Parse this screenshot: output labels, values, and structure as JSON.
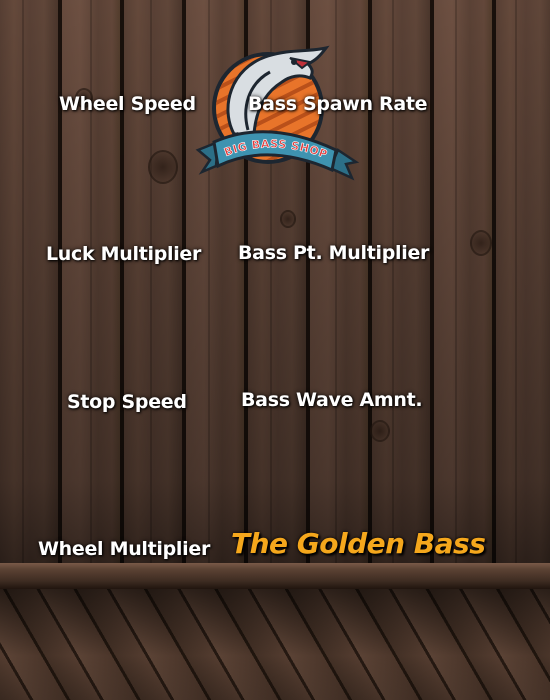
{
  "shop": {
    "logo_text": "BIG BASS SHOP",
    "upgrades": [
      "Wheel Speed",
      "Bass Spawn Rate",
      "Luck Multiplier",
      "Bass Pt. Multiplier",
      "Stop Speed",
      "Bass Wave Amnt.",
      "Wheel Multiplier"
    ],
    "featured": "The Golden Bass"
  },
  "colors": {
    "logo_ring": "#e8742a",
    "logo_banner": "#3e93b0",
    "featured_text": "#f5a71c",
    "label_text": "#ffffff"
  }
}
